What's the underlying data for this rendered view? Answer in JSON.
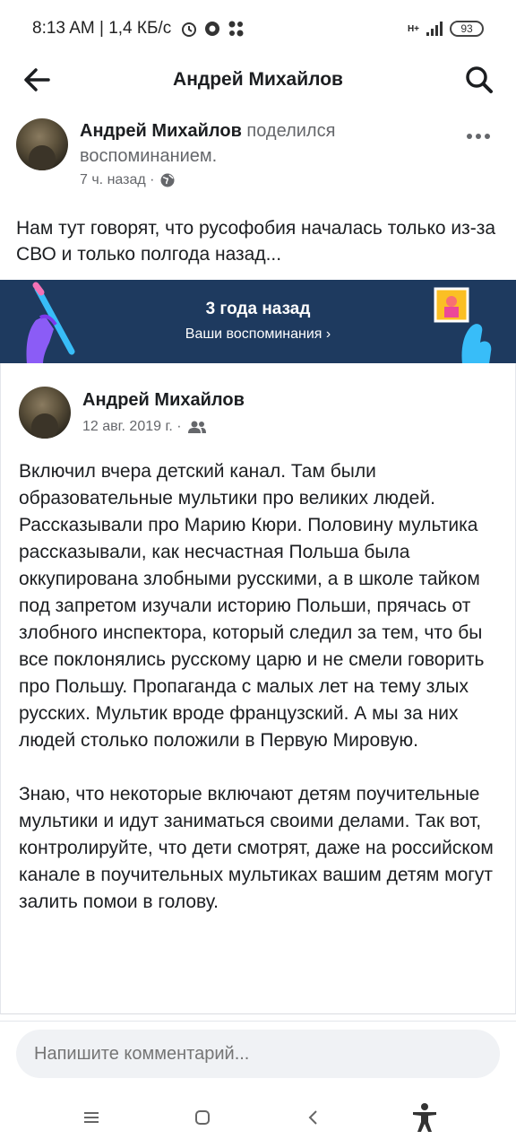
{
  "status_bar": {
    "time_speed": "8:13 AM | 1,4 КБ/с",
    "network_type": "H+",
    "battery": "93"
  },
  "header": {
    "title": "Андрей Михайлов",
    "back_icon": "arrow-left-icon",
    "search_icon": "search-icon"
  },
  "share_post": {
    "author": "Андрей Михайлов",
    "action": "поделился воспоминанием.",
    "time": "7 ч. назад ·",
    "privacy_icon": "globe-icon",
    "text": "Нам тут говорят, что русофобия началась только из-за СВО и только полгода назад..."
  },
  "memory": {
    "title": "3 года назад",
    "link": "Ваши воспоминания ›",
    "background": "#1e3a5f"
  },
  "original_post": {
    "author": "Андрей Михайлов",
    "date": "12 авг. 2019 г. ·",
    "privacy_icon": "friends-icon",
    "paragraph_1": "Включил вчера детский канал. Там были образовательные мультики про великих людей. Рассказывали про Марию Кюри. Половину мультика рассказывали, как несчастная Польша была оккупирована злобными русскими, а в школе тайком под запретом изучали историю Польши, прячась от злобного инспектора, который следил за тем, что бы все поклонялись русскому царю и не смели говорить про Польшу. Пропаганда с малых лет на тему злых русских. Мультик вроде французский. А мы за них людей столько положили в Первую Мировую.",
    "paragraph_2": "Знаю, что некоторые включают детям поучительные мультики и идут заниматься своими делами. Так вот, контролируйте, что дети смотрят, даже на российском канале в поучительных мультиках вашим детям могут залить помои в голову."
  },
  "comment": {
    "placeholder": "Напишите комментарий..."
  },
  "nav": {
    "menu_icon": "menu-icon",
    "home_icon": "home-square-icon",
    "back_icon": "back-chevron-icon",
    "accessibility_icon": "accessibility-icon"
  }
}
